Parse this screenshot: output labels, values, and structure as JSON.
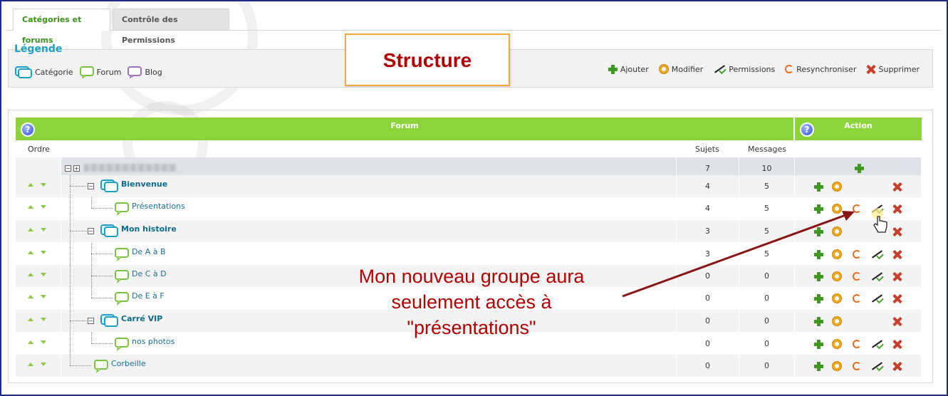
{
  "tabs": [
    {
      "label": "Catégories et forums",
      "active": true
    },
    {
      "label": "Contrôle des Permissions",
      "active": false
    }
  ],
  "legend": {
    "title": "Légende",
    "items": [
      {
        "label": "Catégorie",
        "icon": "category-bubble-icon",
        "color": "#1a9fc0"
      },
      {
        "label": "Forum",
        "icon": "forum-bubble-icon",
        "color": "#7cc242"
      },
      {
        "label": "Blog",
        "icon": "blog-bubble-icon",
        "color": "#a070c0"
      }
    ]
  },
  "actions_legend": [
    {
      "label": "Ajouter",
      "icon": "plus-icon"
    },
    {
      "label": "Modifier",
      "icon": "gear-icon"
    },
    {
      "label": "Permissions",
      "icon": "permissions-icon"
    },
    {
      "label": "Resynchroniser",
      "icon": "sync-icon"
    },
    {
      "label": "Supprimer",
      "icon": "delete-icon"
    }
  ],
  "callout": {
    "text": "Structure"
  },
  "table": {
    "header_forum": "Forum",
    "header_action": "Action",
    "col_order": "Ordre",
    "col_subjects": "Sujets",
    "col_messages": "Messages",
    "rows": [
      {
        "name": "",
        "type": "root",
        "subjects": "7",
        "messages": "10"
      },
      {
        "name": "Bienvenue",
        "type": "category",
        "subjects": "4",
        "messages": "5"
      },
      {
        "name": "Présentations",
        "type": "forum",
        "subjects": "4",
        "messages": "5"
      },
      {
        "name": "Mon histoire",
        "type": "category",
        "subjects": "3",
        "messages": "5"
      },
      {
        "name": "De A à B",
        "type": "forum",
        "subjects": "3",
        "messages": "5"
      },
      {
        "name": "De C à D",
        "type": "forum",
        "subjects": "0",
        "messages": "0"
      },
      {
        "name": "De E à F",
        "type": "forum",
        "subjects": "0",
        "messages": "0"
      },
      {
        "name": "Carré VIP",
        "type": "category",
        "subjects": "0",
        "messages": "0"
      },
      {
        "name": "nos photos",
        "type": "forum",
        "subjects": "0",
        "messages": "0"
      },
      {
        "name": "Corbeille",
        "type": "forum",
        "subjects": "0",
        "messages": "0"
      }
    ]
  },
  "annotation": {
    "line1": "Mon nouveau groupe aura",
    "line2": "seulement accès à",
    "line3": "\"présentations\"",
    "color": "#b00000"
  },
  "colors": {
    "header_green": "#8dd43c",
    "frame_border": "#1b2a86",
    "callout_border": "#f5a640"
  }
}
